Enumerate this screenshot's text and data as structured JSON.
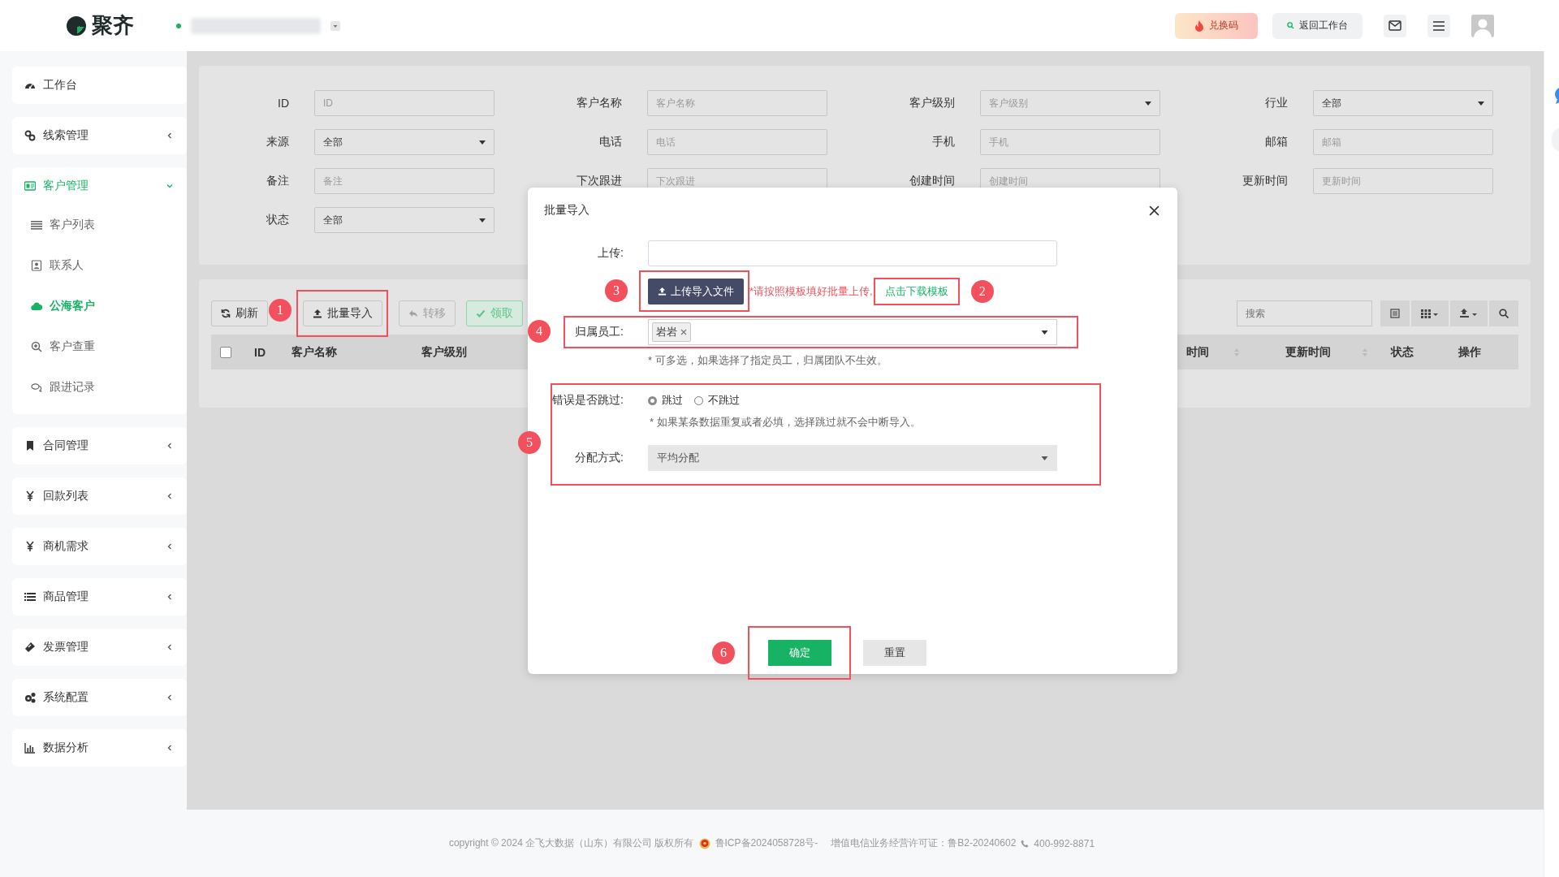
{
  "topbar": {
    "logo": "聚齐",
    "online": true,
    "actions": [
      {
        "kind": "redeem",
        "label": "兑换码"
      },
      {
        "kind": "back",
        "label": "返回工作台"
      },
      {
        "kind": "mail"
      },
      {
        "kind": "menu"
      },
      {
        "kind": "avatar"
      }
    ]
  },
  "sidebar": [
    {
      "label": "工作台",
      "arrow": false
    },
    {
      "label": "线索管理",
      "arrow": true
    },
    {
      "label": "客户管理",
      "expanded": true,
      "arrow": true,
      "children": [
        {
          "label": "客户列表",
          "selected": false
        },
        {
          "label": "联系人",
          "selected": false
        },
        {
          "label": "公海客户",
          "selected": true
        },
        {
          "label": "客户查重",
          "selected": false
        },
        {
          "label": "跟进记录",
          "selected": false
        }
      ]
    },
    {
      "label": "合同管理",
      "arrow": true
    },
    {
      "label": "回款列表",
      "arrow": true
    },
    {
      "label": "商机需求",
      "arrow": true
    },
    {
      "label": "商品管理",
      "arrow": true
    },
    {
      "label": "发票管理",
      "arrow": true
    },
    {
      "label": "系统配置",
      "arrow": true
    },
    {
      "label": "数据分析",
      "arrow": true
    }
  ],
  "filters": [
    {
      "label": "ID",
      "kind": "input",
      "placeholder": "ID"
    },
    {
      "label": "客户名称",
      "kind": "input",
      "placeholder": "客户名称"
    },
    {
      "label": "客户级别",
      "kind": "select",
      "placeholder": "客户级别"
    },
    {
      "label": "行业",
      "kind": "select",
      "value": "全部"
    },
    {
      "label": "来源",
      "kind": "select",
      "value": "全部"
    },
    {
      "label": "电话",
      "kind": "input",
      "placeholder": "电话"
    },
    {
      "label": "手机",
      "kind": "input",
      "placeholder": "手机"
    },
    {
      "label": "邮箱",
      "kind": "input",
      "placeholder": "邮箱"
    },
    {
      "label": "备注",
      "kind": "input",
      "placeholder": "备注"
    },
    {
      "label": "下次跟进",
      "kind": "input",
      "placeholder": "下次跟进"
    },
    {
      "label": "创建时间",
      "kind": "input",
      "placeholder": "创建时间"
    },
    {
      "label": "更新时间",
      "kind": "input",
      "placeholder": "更新时间"
    },
    {
      "label": "状态",
      "kind": "select",
      "value": "全部"
    }
  ],
  "toolbar": [
    {
      "kind": "refresh",
      "label": "刷新",
      "disabled": false
    },
    {
      "kind": "import",
      "label": "批量导入",
      "disabled": false,
      "marker": "1"
    },
    {
      "kind": "transfer",
      "label": "转移",
      "disabled": true
    },
    {
      "kind": "claim",
      "label": "领取",
      "disabled": true
    }
  ],
  "table_search": {
    "placeholder": "搜索"
  },
  "table_tools": [
    {
      "kind": "list"
    },
    {
      "kind": "grid"
    },
    {
      "kind": "export"
    },
    {
      "kind": "search"
    }
  ],
  "table": {
    "select_all_checked": false,
    "columns": [
      {
        "label": "ID",
        "sortable": false
      },
      {
        "label": "客户名称",
        "sortable": false
      },
      {
        "label": "客户级别",
        "sortable": false
      },
      {
        "label": "时间",
        "sortable": true
      },
      {
        "label": "更新时间",
        "sortable": true
      },
      {
        "label": "状态",
        "sortable": false
      },
      {
        "label": "操作",
        "sortable": false
      }
    ]
  },
  "modal": {
    "title": "批量导入",
    "upload_label": "上传:",
    "upload_button": {
      "label": "上传导入文件",
      "marker": "3"
    },
    "upload_note": "*请按照模板填好批量上传,",
    "template_link": {
      "label": "点击下载模板",
      "marker": "2"
    },
    "owner": {
      "label": "归属员工:",
      "tags": [
        "岩岩"
      ],
      "hint": "* 可多选，如果选择了指定员工，归属团队不生效。",
      "marker": "4"
    },
    "skip_section": {
      "marker": "5",
      "label": "错误是否跳过:",
      "options": [
        {
          "label": "跳过",
          "selected": true
        },
        {
          "label": "不跳过",
          "selected": false
        }
      ],
      "hint": "* 如果某条数据重复或者必填，选择跳过就不会中断导入。",
      "assign_label": "分配方式:",
      "assign_value": "平均分配"
    },
    "buttons": [
      {
        "kind": "primary",
        "label": "确定",
        "marker": "6"
      },
      {
        "kind": "default",
        "label": "重置"
      }
    ]
  },
  "footer": {
    "copyright": "copyright © 2024 企飞大数据（山东）有限公司 版权所有",
    "icp": "鲁ICP备2024058728号-",
    "license": "增值电信业务经营许可证：鲁B2-20240602",
    "phone": "400-992-8871"
  }
}
